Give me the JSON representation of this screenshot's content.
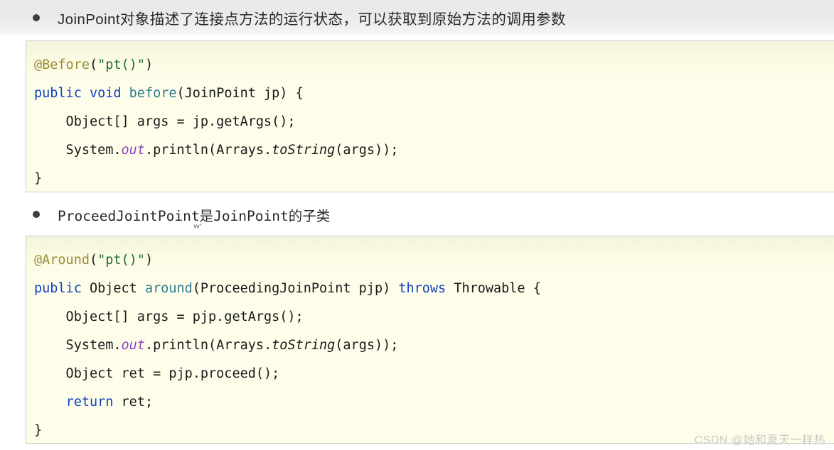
{
  "page": {
    "background_color": "#ffffff",
    "top_band_color": "#eaeaea"
  },
  "bullets": [
    {
      "marker": "bullet-dot",
      "text": "JoinPoint对象描述了连接点方法的运行状态，可以获取到原始方法的调用参数"
    },
    {
      "marker": "bullet-dot",
      "text": "ProceedJointPoint是JoinPoint的子类"
    }
  ],
  "artifact": {
    "text": "ᴡᶠ"
  },
  "code_blocks": [
    {
      "language": "java",
      "background_color": "#fdfdea",
      "border_color": "#c9c9c9",
      "lines": [
        [
          {
            "t": "@Before",
            "c": "anno"
          },
          {
            "t": "(",
            "c": "plain"
          },
          {
            "t": "\"pt()\"",
            "c": "str"
          },
          {
            "t": ")",
            "c": "plain"
          }
        ],
        [
          {
            "t": "public",
            "c": "kw"
          },
          {
            "t": " ",
            "c": "plain"
          },
          {
            "t": "void",
            "c": "kw"
          },
          {
            "t": " ",
            "c": "plain"
          },
          {
            "t": "before",
            "c": "method"
          },
          {
            "t": "(JoinPoint jp) {",
            "c": "plain"
          }
        ],
        [
          {
            "t": "    Object[] args = jp.getArgs();",
            "c": "plain"
          }
        ],
        [
          {
            "t": "    System.",
            "c": "plain"
          },
          {
            "t": "out",
            "c": "field"
          },
          {
            "t": ".println(Arrays.",
            "c": "plain"
          },
          {
            "t": "toString",
            "c": "ital"
          },
          {
            "t": "(args));",
            "c": "plain"
          }
        ],
        [
          {
            "t": "}",
            "c": "plain"
          }
        ]
      ]
    },
    {
      "language": "java",
      "background_color": "#fdfdea",
      "border_color": "#c9c9c9",
      "lines": [
        [
          {
            "t": "@Around",
            "c": "anno"
          },
          {
            "t": "(",
            "c": "plain"
          },
          {
            "t": "\"pt()\"",
            "c": "str"
          },
          {
            "t": ")",
            "c": "plain"
          }
        ],
        [
          {
            "t": "public",
            "c": "kw"
          },
          {
            "t": " Object ",
            "c": "plain"
          },
          {
            "t": "around",
            "c": "method"
          },
          {
            "t": "(ProceedingJoinPoint pjp) ",
            "c": "plain"
          },
          {
            "t": "throws",
            "c": "kw"
          },
          {
            "t": " Throwable {",
            "c": "plain"
          }
        ],
        [
          {
            "t": "    Object[] args = pjp.getArgs();",
            "c": "plain"
          }
        ],
        [
          {
            "t": "    System.",
            "c": "plain"
          },
          {
            "t": "out",
            "c": "field"
          },
          {
            "t": ".println(Arrays.",
            "c": "plain"
          },
          {
            "t": "toString",
            "c": "ital"
          },
          {
            "t": "(args));",
            "c": "plain"
          }
        ],
        [
          {
            "t": "    Object ret = pjp.proceed();",
            "c": "plain"
          }
        ],
        [
          {
            "t": "    ",
            "c": "plain"
          },
          {
            "t": "return",
            "c": "kw"
          },
          {
            "t": " ret;",
            "c": "plain"
          }
        ],
        [
          {
            "t": "}",
            "c": "plain"
          }
        ]
      ]
    }
  ],
  "watermark": {
    "text": "CSDN @她和夏天一样热"
  }
}
